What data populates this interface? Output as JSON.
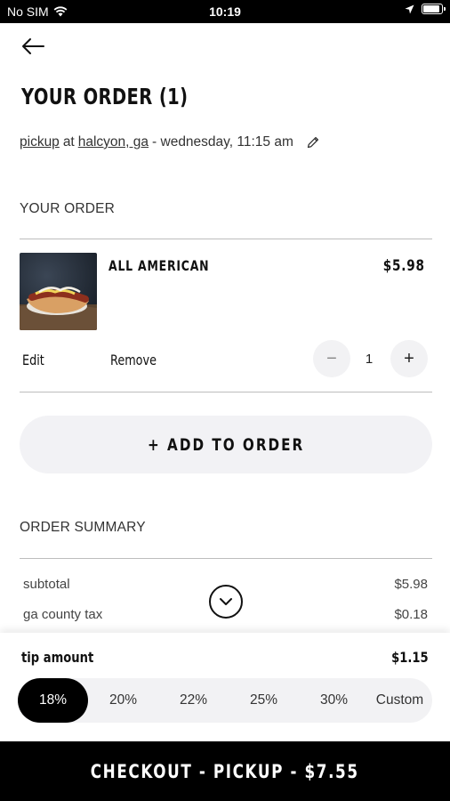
{
  "status_bar": {
    "carrier": "No SIM",
    "time": "10:19"
  },
  "header": {
    "title": "YOUR ORDER (1)"
  },
  "pickup": {
    "mode": "pickup",
    "at": "at",
    "location": "halcyon, ga",
    "when": "- wednesday, 11:15 am"
  },
  "order_section": {
    "label": "YOUR ORDER"
  },
  "item": {
    "name": "ALL AMERICAN",
    "price": "$5.98",
    "edit_label": "Edit",
    "remove_label": "Remove",
    "quantity": "1",
    "minus": "−",
    "plus": "+"
  },
  "add_button": {
    "label": "+ ADD TO ORDER"
  },
  "summary": {
    "label": "ORDER SUMMARY",
    "rows": [
      {
        "label": "subtotal",
        "value": "$5.98"
      },
      {
        "label": "ga county tax",
        "value": "$0.18"
      }
    ]
  },
  "tip": {
    "label": "tip amount",
    "value": "$1.15",
    "options": [
      "18%",
      "20%",
      "22%",
      "25%",
      "30%",
      "Custom"
    ],
    "selected": "18%"
  },
  "checkout": {
    "label": "CHECKOUT - PICKUP - $7.55"
  }
}
